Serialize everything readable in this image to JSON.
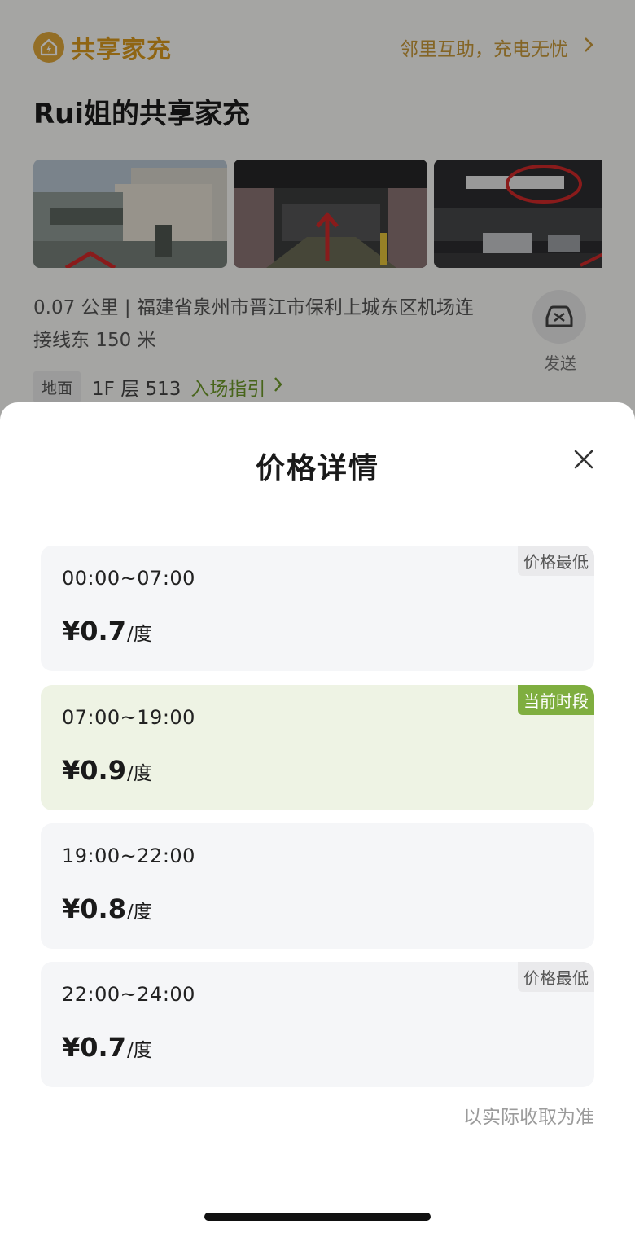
{
  "background": {
    "brand": {
      "name": "共享家充",
      "slogan": "邻里互助，充电无忧"
    },
    "station_title": "Rui姐的共享家充",
    "address": "0.07 公里 | 福建省泉州市晋江市保利上城东区机场连接线东 150 米",
    "send_label": "发送",
    "floor_tag": "地面",
    "floor_text": "1F 层 513",
    "guide_link": "入场指引"
  },
  "sheet": {
    "title": "价格详情",
    "periods": [
      {
        "time": "00:00~07:00",
        "price": "¥0.7",
        "unit": "/度",
        "badge": "价格最低",
        "current": false
      },
      {
        "time": "07:00~19:00",
        "price": "¥0.9",
        "unit": "/度",
        "badge": "当前时段",
        "current": true
      },
      {
        "time": "19:00~22:00",
        "price": "¥0.8",
        "unit": "/度",
        "badge": "",
        "current": false
      },
      {
        "time": "22:00~24:00",
        "price": "¥0.7",
        "unit": "/度",
        "badge": "价格最低",
        "current": false
      }
    ],
    "footnote": "以实际收取为准"
  },
  "colors": {
    "brand": "#d99a1e",
    "current_card_bg": "#eef3e4",
    "current_badge": "#7fae3f",
    "link_green": "#6e9a2a"
  },
  "icons": [
    "home-charge-logo-icon",
    "chevron-right-icon",
    "car-icon",
    "close-icon"
  ]
}
